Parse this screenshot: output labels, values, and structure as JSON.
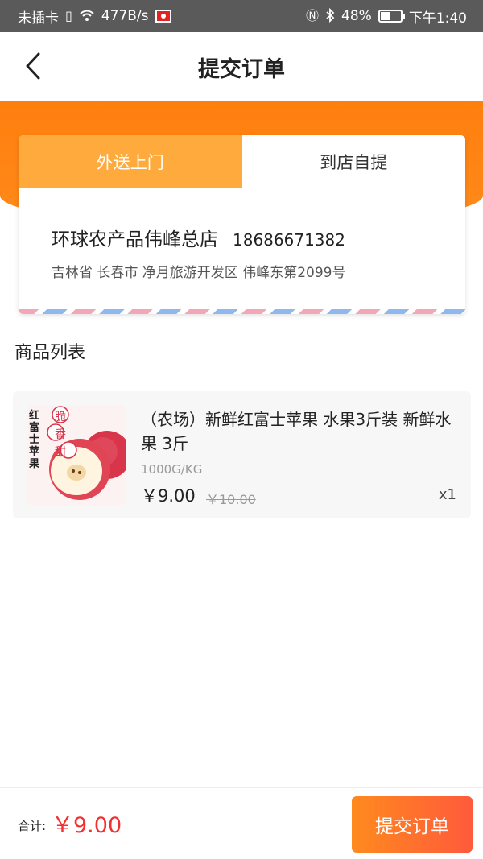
{
  "status_bar": {
    "sim": "未插卡",
    "speed": "477B/s",
    "battery": "48%",
    "time": "下午1:40"
  },
  "header": {
    "title": "提交订单"
  },
  "delivery": {
    "tabs": [
      "外送上门",
      "到店自提"
    ],
    "active_tab": 0,
    "store_name": "环球农产品伟峰总店",
    "phone": "18686671382",
    "address": "吉林省 长春市 净月旅游开发区 伟峰东第2099号"
  },
  "products": {
    "title": "商品列表",
    "items": [
      {
        "name": "（农场）新鲜红富士苹果 水果3斤装 新鲜水果 3斤",
        "spec": "1000G/KG",
        "price": "￥9.00",
        "original_price": "￥10.00",
        "qty": "x1",
        "image_text_left": "红富士苹果",
        "image_text_badge": "脆香甜"
      }
    ]
  },
  "footer": {
    "total_label": "合计:",
    "total_value": "￥9.00",
    "submit_label": "提交订单"
  },
  "colors": {
    "accent": "#ff7f0e",
    "tab_active": "#ffaa3c",
    "price_red": "#f23030"
  }
}
